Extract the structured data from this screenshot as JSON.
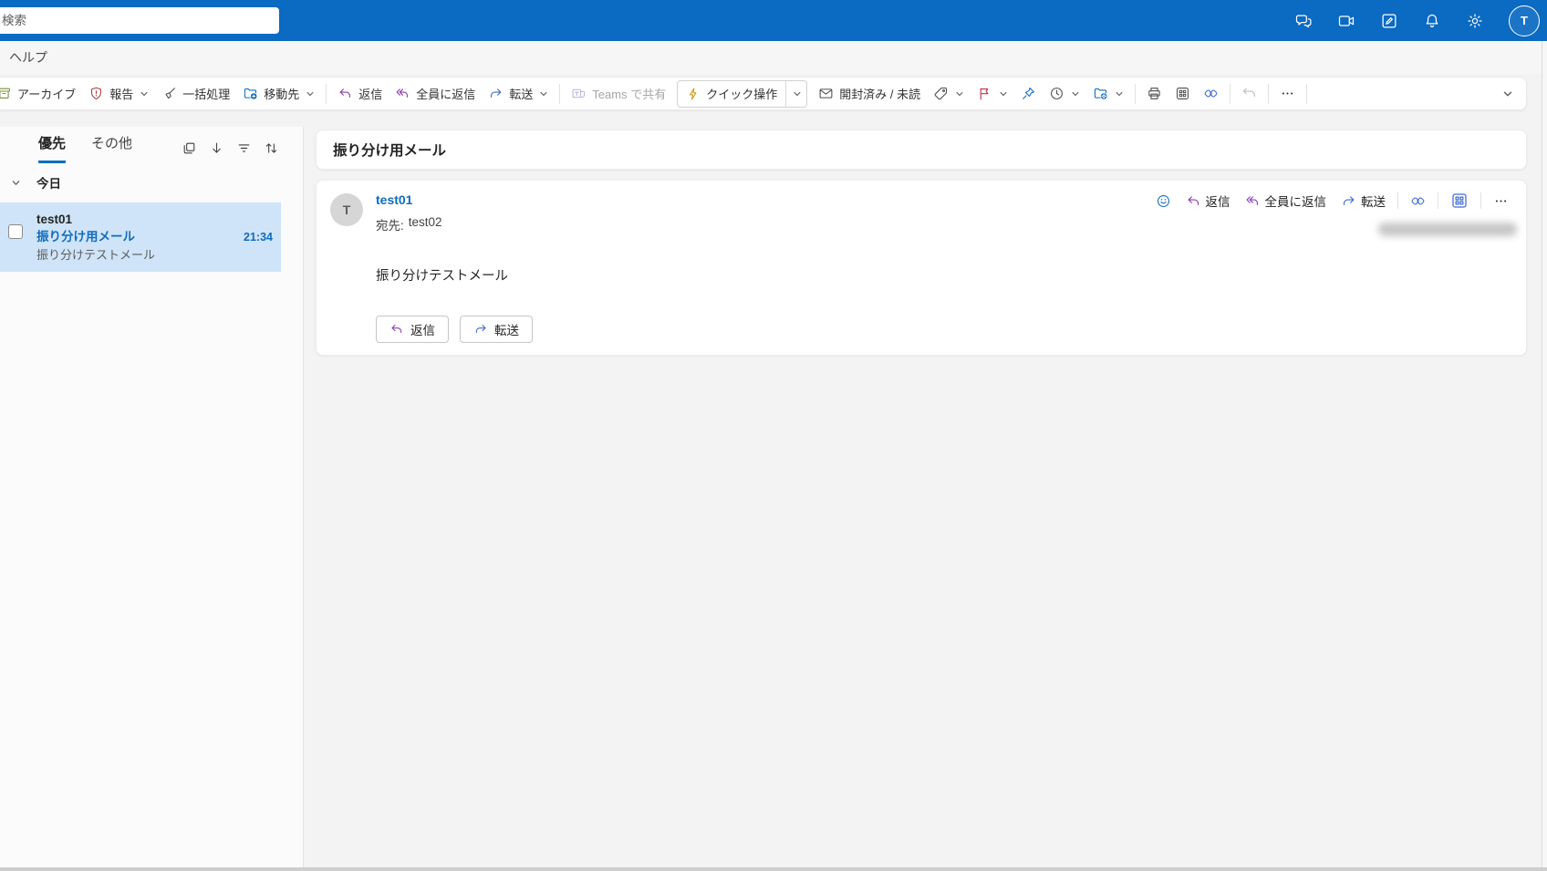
{
  "topbar": {
    "search_placeholder": "検索",
    "avatar_initial": "T",
    "icons": [
      "chat-icon",
      "meet-icon",
      "notes-icon",
      "alerts-icon",
      "settings-icon"
    ]
  },
  "menubar": {
    "help_tab": "ヘルプ"
  },
  "toolbar": {
    "archive": "アーカイブ",
    "report": "報告",
    "sweep": "一括処理",
    "move_to": "移動先",
    "reply": "返信",
    "reply_all": "全員に返信",
    "forward": "転送",
    "share_teams": "Teams で共有",
    "quick_steps": "クイック操作",
    "read_unread": "開封済み / 未読",
    "icon_only": [
      "tag-icon",
      "flag-icon",
      "pin-icon",
      "snooze-icon",
      "rules-icon",
      "print-icon",
      "apps-icon",
      "loop-icon",
      "undo-icon",
      "more-icon",
      "overflow-chevron-icon"
    ]
  },
  "list_pane": {
    "tab_focused": "優先",
    "tab_other": "その他",
    "header_icons": [
      "select-icon",
      "move-down-icon",
      "filter-icon",
      "sort-icon"
    ],
    "group_today": "今日",
    "message": {
      "sender": "test01",
      "subject": "振り分け用メール",
      "time": "21:34",
      "preview": "振り分けテストメール"
    }
  },
  "reading_pane": {
    "subject": "振り分け用メール",
    "message": {
      "avatar_initial": "T",
      "sender": "test01",
      "to_label": "宛先:",
      "to_value": "test02",
      "body": "振り分けテストメール",
      "action_reply": "返信",
      "action_reply_all": "全員に返信",
      "action_forward": "転送",
      "header_icons": [
        "reactions-icon",
        "loop-icon",
        "apps-icon",
        "more-icon"
      ],
      "footer_reply": "返信",
      "footer_forward": "転送"
    }
  },
  "colors": {
    "accent": "#0f6cbd",
    "topbar_bg": "#0b6ac2",
    "selected_mail_bg": "#cfe4f8",
    "reply_purple": "#8a3fb5",
    "forward_blue": "#3e6bd0",
    "flag_red": "#c4314b"
  }
}
